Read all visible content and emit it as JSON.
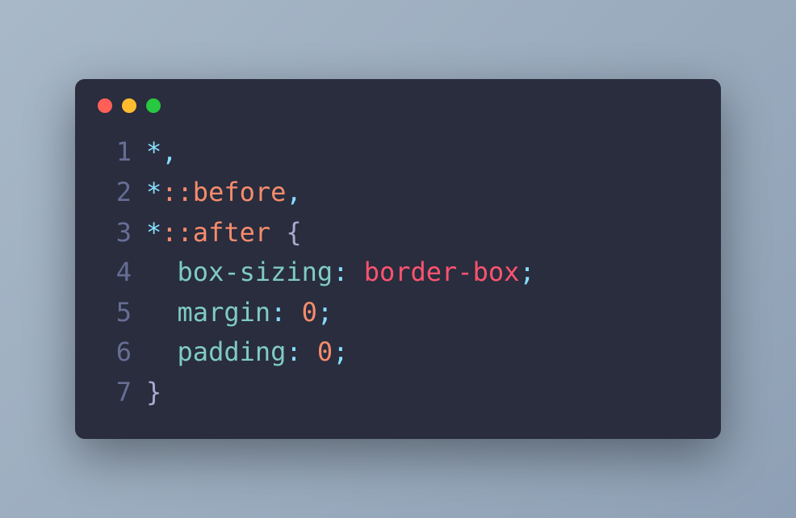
{
  "window": {
    "traffic_lights": [
      "close",
      "minimize",
      "maximize"
    ]
  },
  "code": {
    "lines": [
      {
        "num": "1",
        "tokens": [
          {
            "cls": "tok-star",
            "t": "*"
          },
          {
            "cls": "tok-comma",
            "t": ","
          }
        ]
      },
      {
        "num": "2",
        "tokens": [
          {
            "cls": "tok-star",
            "t": "*"
          },
          {
            "cls": "tok-pseudo",
            "t": "::before"
          },
          {
            "cls": "tok-comma",
            "t": ","
          }
        ]
      },
      {
        "num": "3",
        "tokens": [
          {
            "cls": "tok-star",
            "t": "*"
          },
          {
            "cls": "tok-pseudo",
            "t": "::after"
          },
          {
            "cls": "tok-plain",
            "t": " "
          },
          {
            "cls": "tok-brace",
            "t": "{"
          }
        ]
      },
      {
        "num": "4",
        "tokens": [
          {
            "cls": "tok-plain",
            "t": "  "
          },
          {
            "cls": "tok-prop",
            "t": "box-sizing"
          },
          {
            "cls": "tok-colon",
            "t": ":"
          },
          {
            "cls": "tok-plain",
            "t": " "
          },
          {
            "cls": "tok-value",
            "t": "border-box"
          },
          {
            "cls": "tok-semi",
            "t": ";"
          }
        ]
      },
      {
        "num": "5",
        "tokens": [
          {
            "cls": "tok-plain",
            "t": "  "
          },
          {
            "cls": "tok-prop",
            "t": "margin"
          },
          {
            "cls": "tok-colon",
            "t": ":"
          },
          {
            "cls": "tok-plain",
            "t": " "
          },
          {
            "cls": "tok-number",
            "t": "0"
          },
          {
            "cls": "tok-semi",
            "t": ";"
          }
        ]
      },
      {
        "num": "6",
        "tokens": [
          {
            "cls": "tok-plain",
            "t": "  "
          },
          {
            "cls": "tok-prop",
            "t": "padding"
          },
          {
            "cls": "tok-colon",
            "t": ":"
          },
          {
            "cls": "tok-plain",
            "t": " "
          },
          {
            "cls": "tok-number",
            "t": "0"
          },
          {
            "cls": "tok-semi",
            "t": ";"
          }
        ]
      },
      {
        "num": "7",
        "tokens": [
          {
            "cls": "tok-brace",
            "t": "}"
          }
        ]
      }
    ]
  }
}
